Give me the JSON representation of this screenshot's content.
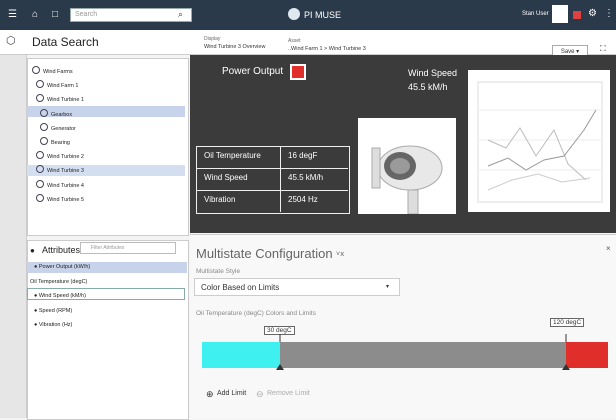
{
  "topbar": {
    "search_placeholder": "Search",
    "brand": "PI MUSE",
    "user": "Stan User"
  },
  "header": {
    "title": "Data Search",
    "display_label": "Display",
    "display_value": "Wind Turbine 3 Overview",
    "asset_label": "Asset",
    "asset_value": "..Wind Farm 1 > Wind Turbine 3",
    "save_label": "Save"
  },
  "tree": {
    "items": [
      {
        "label": "Wind Farms"
      },
      {
        "label": "Wind Farm 1"
      },
      {
        "label": "Wind Turbine 1"
      },
      {
        "label": "Gearbox"
      },
      {
        "label": "Generator"
      },
      {
        "label": "Bearing"
      },
      {
        "label": "Wind Turbine 2"
      },
      {
        "label": "Wind Turbine 3"
      },
      {
        "label": "Wind Turbine 4"
      },
      {
        "label": "Wind Turbine 5"
      }
    ]
  },
  "attributes": {
    "title": "Attributes",
    "filter_placeholder": "Filter Attributes",
    "items": [
      {
        "label": "Power Output (kW/h)"
      },
      {
        "label": "Oil Temperature (degC)"
      },
      {
        "label": "Wind Speed (kM/h)"
      },
      {
        "label": "Speed (RPM)"
      },
      {
        "label": "Vibration (Hz)"
      }
    ]
  },
  "display": {
    "power_output_label": "Power Output",
    "power_output_color": "#e02e2a",
    "wind_speed_label": "Wind Speed",
    "wind_speed_value": "45.5 kM/h",
    "table": [
      {
        "name": "Oil Temperature",
        "value": "16 degF"
      },
      {
        "name": "Wind Speed",
        "value": "45.5 kM/h"
      },
      {
        "name": "Vibration",
        "value": "2504 Hz"
      }
    ]
  },
  "config": {
    "title": "Multistate Configuration",
    "style_label": "Multistate Style",
    "style_value": "Color Based on Limits",
    "limits_label": "Oil Temperature (degC) Colors and Limits",
    "limit_low": "30 degC",
    "limit_high": "120 degC",
    "state_colors": [
      "#3ef0f0",
      "#8c8c8c",
      "#e02e2a"
    ],
    "add_limit": "Add Limit",
    "remove_limit": "Remove Limit"
  }
}
